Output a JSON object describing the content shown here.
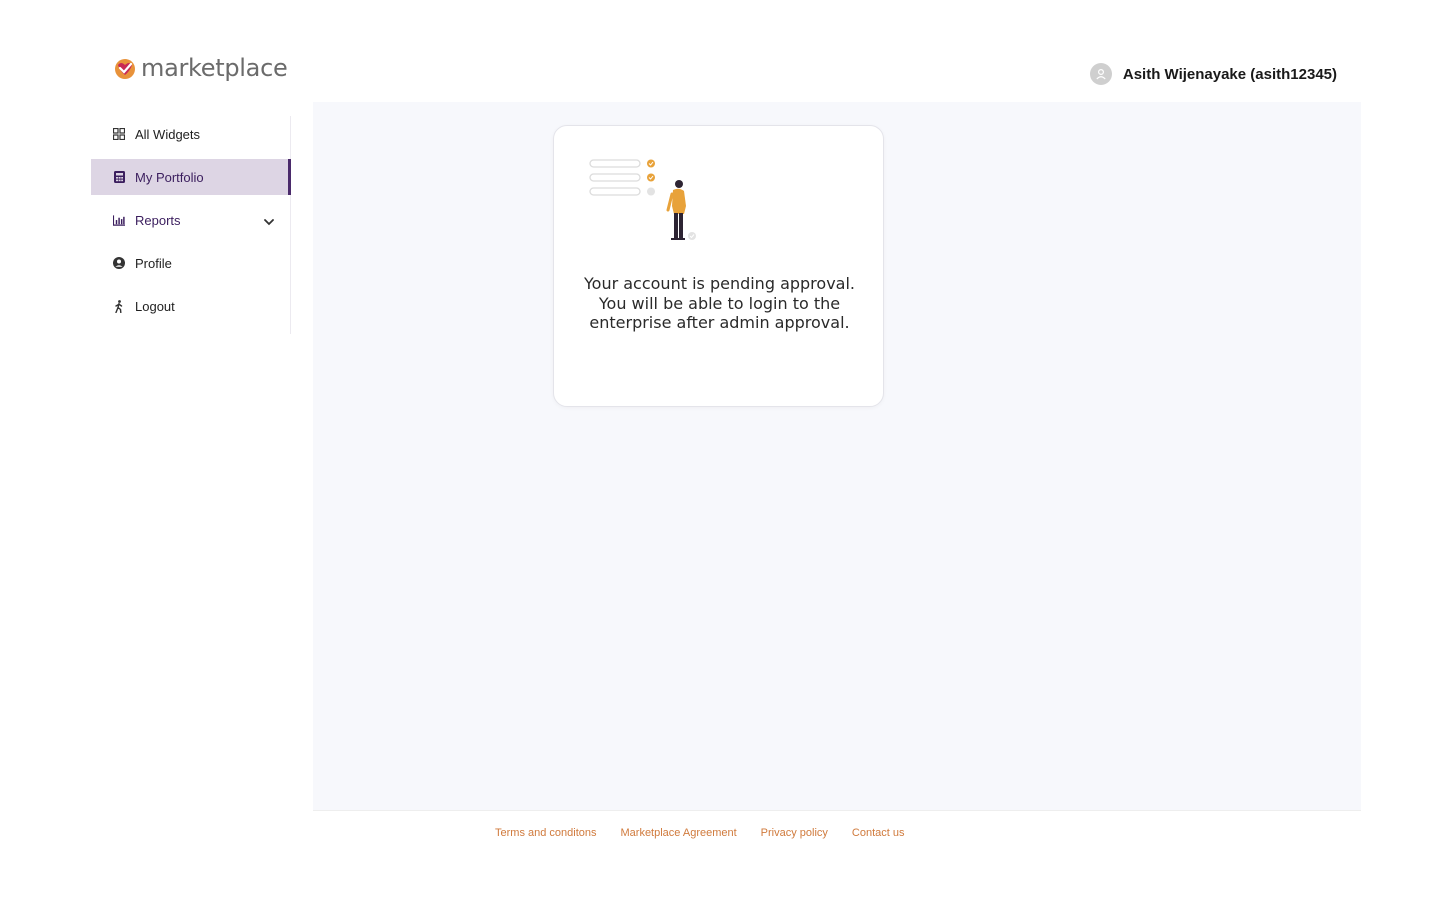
{
  "brand": {
    "name": "marketplace",
    "accent": "#e8923a",
    "primary": "#4a2a6b"
  },
  "sidebar": {
    "items": [
      {
        "label": "All Widgets",
        "icon": "grid-icon"
      },
      {
        "label": "My Portfolio",
        "icon": "calculator-icon",
        "active": true
      },
      {
        "label": "Reports",
        "icon": "bar-chart-icon",
        "expandable": true
      },
      {
        "label": "Profile",
        "icon": "user-circle-icon"
      },
      {
        "label": "Logout",
        "icon": "walking-person-icon"
      }
    ]
  },
  "header": {
    "user_name": "Asith Wijenayake (asith12345)",
    "avatar_icon": "user-avatar-icon"
  },
  "main": {
    "card": {
      "illustration": "person-checklist-illustration",
      "message": "Your account is pending approval. You will be able to login to the enterprise after admin approval."
    }
  },
  "footer": {
    "links": [
      "Terms and conditons",
      "Marketplace Agreement",
      "Privacy policy",
      "Contact us"
    ]
  }
}
